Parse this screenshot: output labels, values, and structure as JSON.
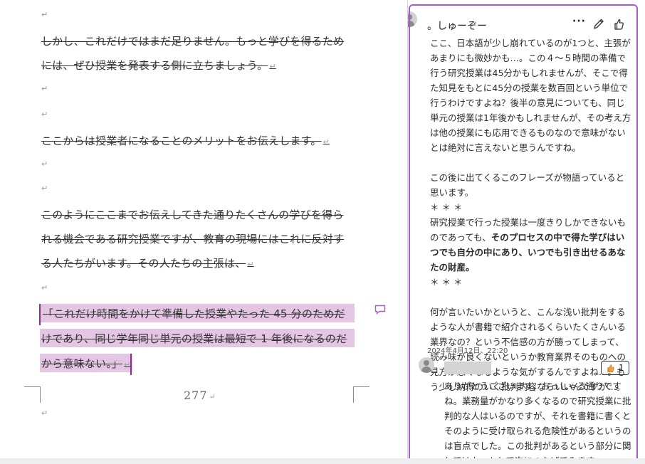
{
  "document": {
    "lines": [
      "しかし、これだけではまだ足りません。もっと学びを得るため",
      "には、ぜひ授業を発表する側に立ちましょう。",
      "ここからは授業者になることのメリットをお伝えします。",
      "このようにここまでお伝えしてきた通りたくさんの学びを得ら",
      "れる機会である研究授業ですが、教育の現場にはこれに反対す",
      "る人たちがいます。その人たちの主張は、"
    ],
    "highlight_lines": [
      "「これだけ時間をかけて準備した授業やたった 45 分のためだ",
      "けであり、同じ学年同じ単元の授業は最短で 1 年後になるのだ",
      "から意味ない。」"
    ],
    "para_mark": "↵",
    "page_number": "277"
  },
  "comment": {
    "author": "。しゅーぞー",
    "more_label": "···",
    "body": [
      "ここ、日本語が少し崩れているのが1つと、主張があまりにも微妙かも…。この４～５時間の準備で行う研究授業は45分かもしれませんが、そこで得た知見をもとに45分の授業を数百回という単位で行うわけですよね？後半の意見についても、同じ単元の授業は1年後かもしれませんが、その考え方は他の授業にも応用できるものなので意味がないとは絶対に言えないと思うんですね。",
      "",
      "この後に出てくるこのフレーズが物語っていると思います。",
      "＊＊＊",
      "研究授業で行った授業は一度きりしかできないものであっても、",
      "そのプロセスの中で得た学びはいつでも自分の中にあり、いつでも引き出せるあなたの財産。",
      "＊＊＊",
      "",
      "何が言いたいかというと、こんな浅い批判をするような人が書籍で紹介されるくらいたくさんいる業界なの？という不信感の方が勝ってしまって、読み味が良くないというか教育業界そのものへの見方が悪くなるような気がするんですよね…。もう少し納得のいく批判内容ならいいんですが…。"
    ],
    "timestamp": "2024年4月12日、22:20"
  },
  "reply": {
    "like_count": "1",
    "body": "ありがとうございます。おっしゃる通りですね。業務量がかなり多くなるので研究授業に批判的な人はいるのですが、それを書籍に書くとそのように受け取られる危険性があるというのは盲点でした。この批判があるという部分に関してはカットして次につなげてみます。"
  },
  "colors": {
    "highlight": "#e4c6e4",
    "accent": "#a45ec4",
    "change_bar": "#8a2f8a"
  }
}
